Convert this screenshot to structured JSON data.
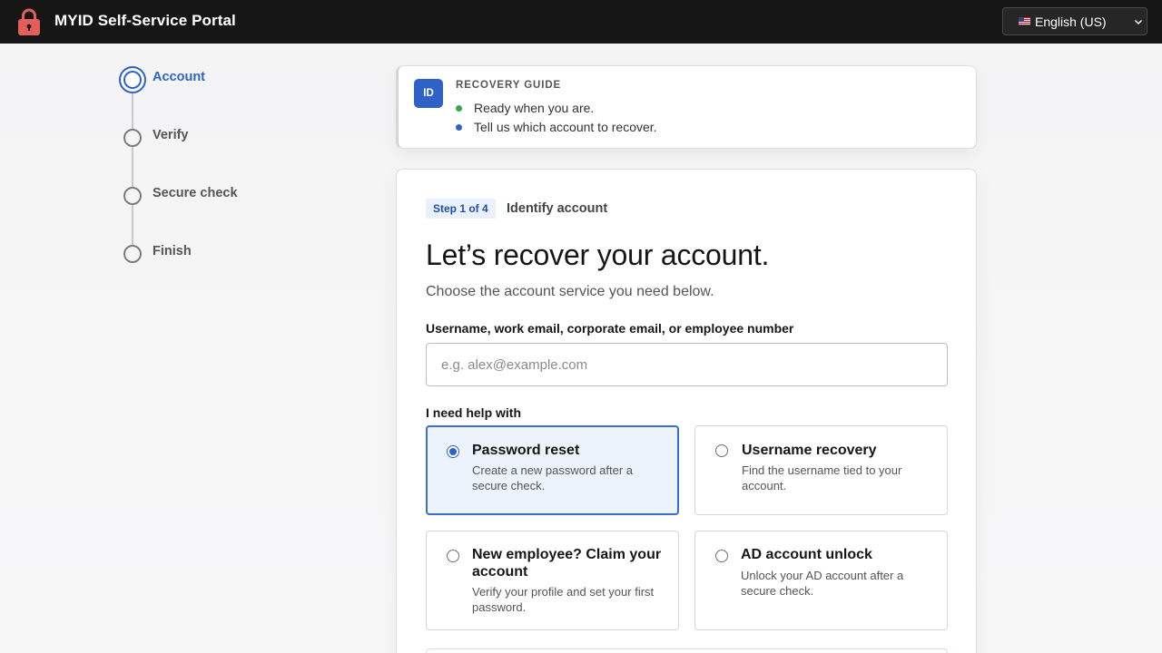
{
  "header": {
    "app_title": "MYID Self-Service Portal",
    "language": "English (US)",
    "icons": {
      "brand": "lock-icon",
      "flag": "us-flag-icon",
      "dropdown": "chevron-down-icon"
    }
  },
  "stepper": {
    "steps": [
      {
        "label": "Account",
        "state": "active"
      },
      {
        "label": "Verify",
        "state": "pending"
      },
      {
        "label": "Secure check",
        "state": "pending"
      },
      {
        "label": "Finish",
        "state": "pending"
      }
    ]
  },
  "guide": {
    "badge": "ID",
    "title": "RECOVERY GUIDE",
    "lines": [
      {
        "text": "Ready when you are.",
        "status": "green"
      },
      {
        "text": "Tell us which account to recover.",
        "status": "blue"
      }
    ]
  },
  "form": {
    "step_badge": "Step 1 of 4",
    "step_name": "Identify account",
    "title": "Let’s recover your account.",
    "subtitle": "Choose the account service you need below.",
    "id_label": "Username, work email, corporate email, or employee number",
    "id_placeholder": "e.g. alex@example.com",
    "id_value": "",
    "help_label": "I need help with",
    "options": [
      {
        "title": "Password reset",
        "desc": "Create a new password after a secure check.",
        "selected": true
      },
      {
        "title": "Username recovery",
        "desc": "Find the username tied to your account.",
        "selected": false
      },
      {
        "title": "New employee? Claim your account",
        "desc": "Verify your profile and set your first password.",
        "selected": false
      },
      {
        "title": "AD account unlock",
        "desc": "Unlock your AD account after a secure check.",
        "selected": false
      }
    ]
  },
  "colors": {
    "topbar": "#161616",
    "accent": "#2f62c7",
    "brand_lock": "#e35d5b",
    "selected_bg": "#edf3fd",
    "status_green": "#3aa655"
  }
}
